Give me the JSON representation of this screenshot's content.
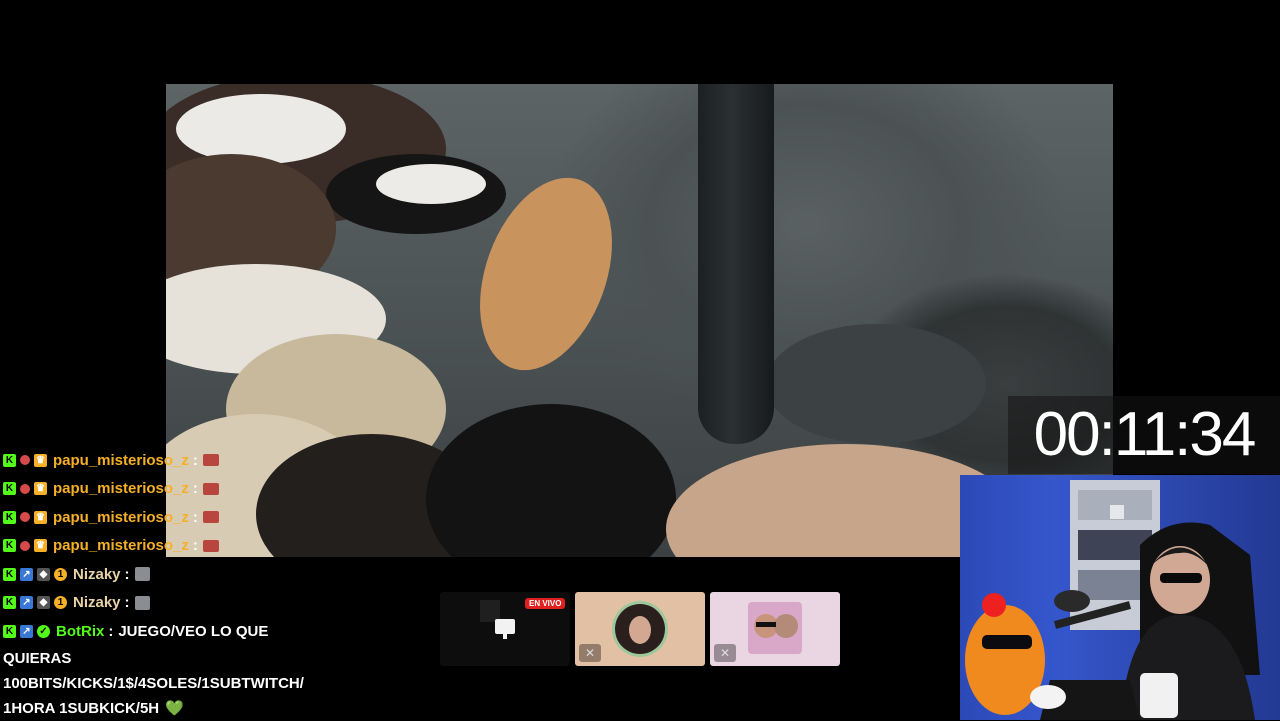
{
  "timer": {
    "text": "00:11:34"
  },
  "chat": {
    "messages": [
      {
        "user": "papu_misterioso_z",
        "user_color": "#f5b028",
        "text": "",
        "emote": "lips-emote"
      },
      {
        "user": "papu_misterioso_z",
        "user_color": "#f5b028",
        "text": "",
        "emote": "lips-emote"
      },
      {
        "user": "papu_misterioso_z",
        "user_color": "#f5b028",
        "text": "",
        "emote": "lips-emote"
      },
      {
        "user": "papu_misterioso_z",
        "user_color": "#f5b028",
        "text": "",
        "emote": "lips-emote"
      },
      {
        "user": "Nizaky",
        "user_color": "#e7d3a6",
        "text": "",
        "emote": "cat-emote"
      },
      {
        "user": "Nizaky",
        "user_color": "#e7d3a6",
        "text": "",
        "emote": "cat-emote"
      },
      {
        "user": "BotRix",
        "user_color": "#53fc18",
        "text": "JUEGO/VEO LO QUE"
      }
    ],
    "continuation": [
      "QUIERAS",
      "100BITS/KICKS/1$/4SOLES/1SUBTWITCH/",
      "1HORA 1SUBKICK/5H"
    ],
    "heart_emoji": "💚",
    "colon": ":"
  },
  "guests": {
    "live_badge": "EN VIVO"
  },
  "colors": {
    "kick_green": "#53fc18",
    "live_red": "#e01f1f"
  }
}
